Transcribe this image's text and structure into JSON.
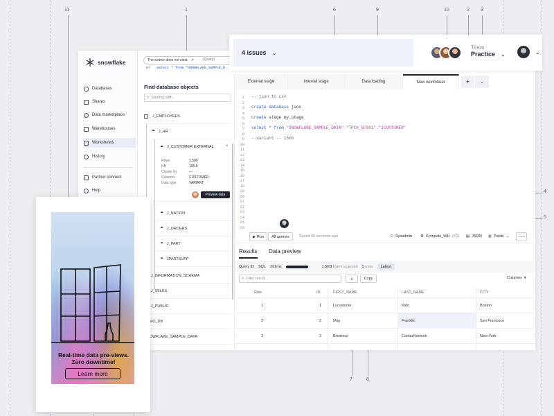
{
  "callouts": [
    "1",
    "2",
    "3",
    "4",
    "5",
    "6",
    "7",
    "8",
    "9",
    "10",
    "11"
  ],
  "header": {
    "issues_label": "4 issues",
    "team_label": "Team",
    "team_name": "Practice"
  },
  "sidebar": {
    "logo": "snowflake",
    "items": [
      {
        "label": "Databases",
        "icon": "database-icon"
      },
      {
        "label": "Shares",
        "icon": "share-icon"
      },
      {
        "label": "Data marketplace",
        "icon": "marketplace-icon"
      },
      {
        "label": "Warehouses",
        "icon": "warehouse-icon"
      },
      {
        "label": "Worksheets",
        "icon": "worksheet-icon"
      },
      {
        "label": "History",
        "icon": "history-icon"
      },
      {
        "label": "Partner connect",
        "icon": "partner-icon"
      },
      {
        "label": "Help",
        "icon": "help-icon"
      }
    ]
  },
  "tooltip": {
    "text": "The source does not exist.",
    "tag": "(Query)",
    "line_no": "07",
    "code": "select * from \"SNOWFLAKE_SAMPLE_D"
  },
  "find": {
    "title": "Find database objects",
    "placeholder": "Starting with..."
  },
  "tree": {
    "employees": "J_EMPLOYEES",
    "hr": "J_HR",
    "customer_external": "J_CUSTOMER EXTERNAL",
    "details": [
      {
        "k": "Rows",
        "v": "1,500"
      },
      {
        "k": "KB",
        "v": "106.5"
      },
      {
        "k": "Cluster by",
        "v": "---"
      },
      {
        "k": "Columns",
        "v": "CUSTOMER"
      },
      {
        "k": "Data type",
        "v": "VARIANT"
      }
    ],
    "preview_button": "Preview data",
    "nation": "J_NATION",
    "orders": "J_ORDERS",
    "part": "J_PART",
    "partsupp": "JPARTSUPP",
    "information_schema": "J_INFORMATION_SCHEMA",
    "seles": "J_SELES",
    "public": "J_PUBLIC",
    "demo_db": "DEMO_DB",
    "sample_data": "SNOWFLAKE_SAMPLE_DATA"
  },
  "tabs": [
    "External stage",
    "Internal stage",
    "Data loading",
    "New worksheet"
  ],
  "editor": {
    "line_numbers": [
      "1",
      "2",
      "3",
      "4",
      "5",
      "6",
      "7",
      "8",
      "9",
      "10",
      "11",
      "12",
      "13",
      "14",
      "15",
      "16",
      "17",
      "18",
      "19",
      "20",
      "21",
      "22",
      "23",
      "24",
      "25",
      "26"
    ],
    "lines": [
      {
        "parts": [
          {
            "t": "-- json to csv",
            "c": "cmt"
          }
        ]
      },
      {
        "parts": [
          {
            "t": "create database ",
            "c": "kw"
          },
          {
            "t": "json",
            "c": ""
          }
        ]
      },
      {
        "parts": [
          {
            "t": "create ",
            "c": "kw"
          },
          {
            "t": "stage my_stage",
            "c": ""
          }
        ]
      },
      {
        "parts": [
          {
            "t": "select ",
            "c": "kw"
          },
          {
            "t": "* ",
            "c": ""
          },
          {
            "t": "from ",
            "c": "kw"
          },
          {
            "t": "\"SNOWFLAKE_SAMPLE_DATA\".\"TPCH_SF001\".\"JCUSTOMER\"",
            "c": "str"
          }
        ]
      },
      {
        "parts": [
          {
            "t": "--variant -- 16mb",
            "c": "cmt"
          }
        ]
      }
    ]
  },
  "runbar": {
    "run": "Run",
    "all_queries": "All queries",
    "saved": "Saved 09 seconds ago",
    "role": "Sysadmin",
    "warehouse": "Compute_WH",
    "warehouse_size": "(XS)",
    "format": "JSON",
    "visibility": "Public"
  },
  "results": {
    "tab_results": "Results",
    "tab_preview": "Data preview",
    "query_id": "Query ID",
    "sql": "SQL",
    "duration": "261ms",
    "progress": 1,
    "scanned": "1.5KB",
    "scanned_suffix": "bytes scanned",
    "rows_count": "5",
    "rows_suffix": "rows",
    "latest": "Latest",
    "filter_placeholder": "Filter result...",
    "copy": "Copy",
    "columns": "Columns",
    "headers": [
      "Row",
      "ID",
      "FIRST_NAME",
      "LAST_NAME",
      "CITY"
    ],
    "rows": [
      [
        "1",
        "1",
        "Lucasionio",
        "Kido",
        "Boston"
      ],
      [
        "2",
        "2",
        "May",
        "Franklin",
        "San Francisco"
      ],
      [
        "3",
        "3",
        "Breanna",
        "Camachonison",
        "New York"
      ]
    ]
  },
  "promo": {
    "headline": "Real-time data pre-views. Zero downtime!",
    "button": "Learn more"
  },
  "colors": {
    "accent": "#1e5bd6",
    "string": "#c23ba8",
    "issues_bg": "#edf2fb",
    "active_nav": "#e7ecf6"
  }
}
